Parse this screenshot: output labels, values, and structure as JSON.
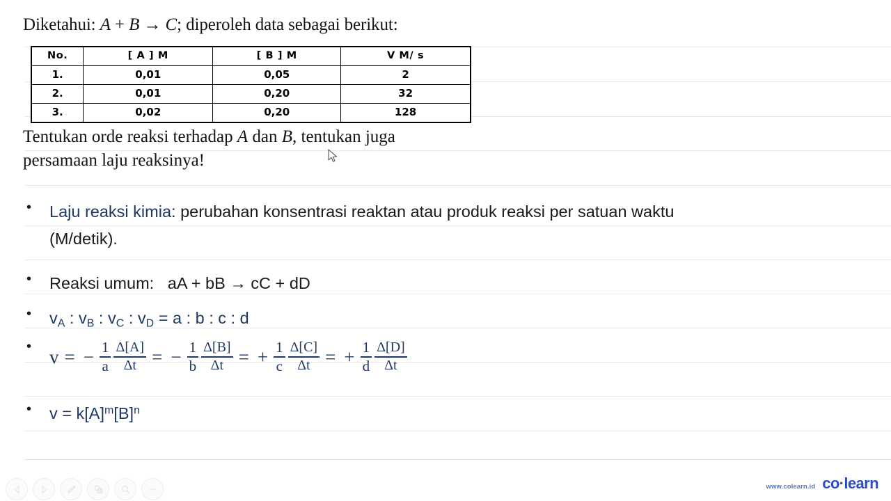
{
  "question": {
    "title_prefix": "Diketahui: ",
    "title_reaction_a": "A",
    "title_plus": " + ",
    "title_reaction_b": "B",
    "title_arrow": " → ",
    "title_reaction_c": "C",
    "title_suffix": "; diperoleh data sebagai berikut:",
    "table": {
      "headers": [
        "No.",
        "[ A ] M",
        "[ B ] M",
        "V M/ s"
      ],
      "rows": [
        [
          "1.",
          "0,01",
          "0,05",
          "2"
        ],
        [
          "2.",
          "0,01",
          "0,20",
          "32"
        ],
        [
          "3.",
          "0,02",
          "0,20",
          "128"
        ]
      ]
    },
    "ask_line1_a": "Tentukan orde reaksi terhadap ",
    "ask_line1_var1": "A",
    "ask_line1_b": " dan ",
    "ask_line1_var2": "B",
    "ask_line1_c": ", tentukan juga",
    "ask_line2": "persamaan laju reaksinya!"
  },
  "notes": {
    "bullet_char": "•",
    "item1": {
      "term": "Laju reaksi kimia",
      "definition": ": perubahan konsentrasi reaktan atau produk reaksi per satuan waktu",
      "line2": "(M/detik)."
    },
    "item2": {
      "label": "Reaksi umum:",
      "equation": "aA + bB → cC + dD"
    },
    "item3": {
      "v": "v",
      "sub_a": "A",
      "sep1": " : ",
      "sub_b": "B",
      "sep2": " : ",
      "sub_c": "C",
      "sep3": " : ",
      "sub_d": "D",
      "equals": " = a : b : c : d"
    },
    "item4": {
      "lhs": "v",
      "eq1": "=",
      "sign1": "−",
      "f1_num": "1",
      "f1_den": "a",
      "f2_num": "Δ[A]",
      "f2_den": "Δt",
      "eq2": "=",
      "sign2": "−",
      "f3_num": "1",
      "f3_den": "b",
      "f4_num": "Δ[B]",
      "f4_den": "Δt",
      "eq3": "=",
      "sign3": "+",
      "f5_num": "1",
      "f5_den": "c",
      "f6_num": "Δ[C]",
      "f6_den": "Δt",
      "eq4": "=",
      "sign4": "+",
      "f7_num": "1",
      "f7_den": "d",
      "f8_num": "Δ[D]",
      "f8_den": "Δt"
    },
    "item5": {
      "expr_a": "v = k[A]",
      "sup_m": "m",
      "expr_b": "[B]",
      "sup_n": "n"
    }
  },
  "toolbar": {
    "items": [
      {
        "name": "previous-button",
        "icon": "triangle-left-icon"
      },
      {
        "name": "next-button",
        "icon": "triangle-right-icon"
      },
      {
        "name": "pen-button",
        "icon": "pen-icon"
      },
      {
        "name": "shapes-button",
        "icon": "shapes-icon"
      },
      {
        "name": "zoom-button",
        "icon": "magnifier-icon"
      },
      {
        "name": "more-button",
        "icon": "ellipsis-icon"
      }
    ]
  },
  "brand": {
    "url": "www.colearn.id",
    "name": "co·learn"
  },
  "colors": {
    "accent_blue": "#1F3864",
    "brand_blue": "#2b4ec0",
    "text_black": "#1a1a1a",
    "rule_line": "#e8e8e8"
  }
}
